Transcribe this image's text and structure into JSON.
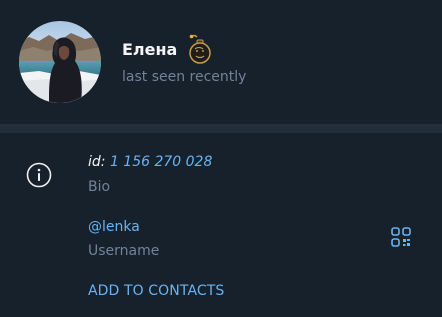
{
  "profile": {
    "name": "Елена",
    "status": "last seen recently",
    "emoji_icon": "bomb-emoji-icon"
  },
  "info": {
    "id_prefix": "id:",
    "id_value": "1 156 270 028",
    "bio_label": "Bio",
    "username_value": "@lenka",
    "username_label": "Username",
    "add_contacts_label": "ADD TO CONTACTS"
  },
  "colors": {
    "background": "#17212b",
    "divider": "#232e3c",
    "primary_text": "#f5f5f5",
    "secondary_text": "#708499",
    "accent": "#6ab2f2"
  }
}
